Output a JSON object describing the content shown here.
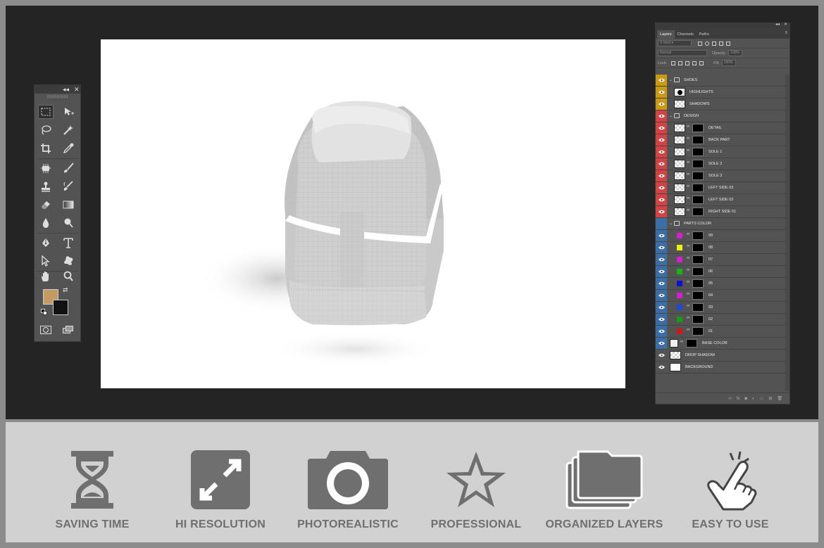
{
  "colors": {
    "frame": "#8c8c8c",
    "workspace": "#242424",
    "panel": "#535353",
    "foreground_swatch": "#c49a63",
    "background_swatch": "#111111",
    "eye_yellow": "#c99a12",
    "eye_red": "#d24343",
    "eye_blue": "#3b6ea5",
    "feature_icon": "#6f6f6f",
    "feature_bg": "#d1d1d1"
  },
  "toolbar": {
    "tools": [
      {
        "name": "marquee-tool-icon",
        "selected": true
      },
      {
        "name": "move-tool-icon"
      },
      {
        "name": "lasso-tool-icon"
      },
      {
        "name": "magic-wand-tool-icon"
      },
      {
        "name": "crop-tool-icon"
      },
      {
        "name": "eyedropper-tool-icon"
      },
      {
        "name": "healing-brush-tool-icon"
      },
      {
        "name": "brush-tool-icon"
      },
      {
        "name": "clone-stamp-tool-icon"
      },
      {
        "name": "history-brush-tool-icon"
      },
      {
        "name": "eraser-tool-icon"
      },
      {
        "name": "gradient-tool-icon"
      },
      {
        "name": "blur-tool-icon"
      },
      {
        "name": "dodge-tool-icon"
      },
      {
        "name": "pen-tool-icon"
      },
      {
        "name": "type-tool-icon"
      },
      {
        "name": "path-selection-tool-icon"
      },
      {
        "name": "shape-tool-icon"
      },
      {
        "name": "hand-tool-icon"
      },
      {
        "name": "zoom-tool-icon"
      }
    ]
  },
  "layers_panel": {
    "tabs": [
      "Layers",
      "Channels",
      "Paths"
    ],
    "filter_kind": "Kind",
    "blend_mode": "Normal",
    "opacity_label": "Opacity:",
    "opacity_value": "100%",
    "lock_label": "Lock:",
    "fill_label": "Fill:",
    "fill_value": "100%",
    "layers": [
      {
        "name": "SHOES",
        "type": "group",
        "eye": "yellow",
        "indent": 0
      },
      {
        "name": "HIGHLIGHTS",
        "type": "layer",
        "eye": "yellow",
        "thumb": "shoe",
        "indent": 1
      },
      {
        "name": "SHADOWS",
        "type": "layer",
        "eye": "yellow",
        "thumb": "checker",
        "indent": 1
      },
      {
        "name": "DESIGN",
        "type": "group",
        "eye": "red",
        "indent": 0
      },
      {
        "name": "DETAIL",
        "type": "smart",
        "eye": "red",
        "indent": 1
      },
      {
        "name": "BACK PART",
        "type": "smart",
        "eye": "red",
        "indent": 1
      },
      {
        "name": "SOLE 1",
        "type": "smart",
        "eye": "red",
        "indent": 1
      },
      {
        "name": "SOLE 2",
        "type": "smart",
        "eye": "red",
        "indent": 1
      },
      {
        "name": "SOLE 3",
        "type": "smart",
        "eye": "red",
        "indent": 1
      },
      {
        "name": "LEFT SIDE 03",
        "type": "smart",
        "eye": "red",
        "indent": 1
      },
      {
        "name": "LEFT SIDE 02",
        "type": "smart",
        "eye": "red",
        "indent": 1
      },
      {
        "name": "RIGHT SIDE 01",
        "type": "smart",
        "eye": "red",
        "indent": 1
      },
      {
        "name": "PARTS COLOR",
        "type": "group",
        "eye": "blue",
        "eye_hidden": true,
        "indent": 0
      },
      {
        "name": "09",
        "type": "color",
        "eye": "blue",
        "color": "#d21fd2",
        "indent": 1
      },
      {
        "name": "08",
        "type": "color",
        "eye": "blue",
        "color": "#f0f000",
        "indent": 1
      },
      {
        "name": "07",
        "type": "color",
        "eye": "blue",
        "color": "#d21fd2",
        "indent": 1
      },
      {
        "name": "06",
        "type": "color",
        "eye": "blue",
        "color": "#16b516",
        "indent": 1
      },
      {
        "name": "05",
        "type": "color",
        "eye": "blue",
        "color": "#1010d0",
        "indent": 1
      },
      {
        "name": "04",
        "type": "color",
        "eye": "blue",
        "color": "#d21fd2",
        "indent": 1
      },
      {
        "name": "03",
        "type": "color",
        "eye": "blue",
        "color": "#1d48d8",
        "indent": 1
      },
      {
        "name": "02",
        "type": "color",
        "eye": "blue",
        "color": "#169c16",
        "indent": 1
      },
      {
        "name": "01",
        "type": "color",
        "eye": "blue",
        "color": "#d01818",
        "indent": 1
      },
      {
        "name": "BASE COLOR",
        "type": "base",
        "eye": "blue",
        "indent": 0
      },
      {
        "name": "DROP SHADOW",
        "type": "layer",
        "eye": "none",
        "thumb": "checker",
        "indent": 0
      },
      {
        "name": "BACKGROUND",
        "type": "layer",
        "eye": "none",
        "thumb": "white",
        "indent": 0
      }
    ]
  },
  "features": [
    {
      "label": "SAVING TIME",
      "icon": "hourglass-icon"
    },
    {
      "label": "HI RESOLUTION",
      "icon": "expand-arrows-icon"
    },
    {
      "label": "PHOTOREALISTIC",
      "icon": "camera-icon"
    },
    {
      "label": "PROFESSIONAL",
      "icon": "star-icon"
    },
    {
      "label": "ORGANIZED LAYERS",
      "icon": "stacked-folders-icon"
    },
    {
      "label": "EASY TO USE",
      "icon": "tap-hand-icon"
    }
  ]
}
